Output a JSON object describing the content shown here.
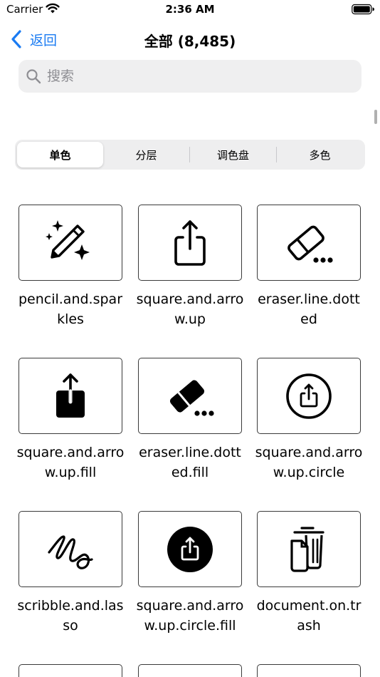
{
  "status": {
    "carrier": "Carrier",
    "time": "2:36 AM"
  },
  "nav": {
    "back_label": "返回",
    "title": "全部 (8,485)"
  },
  "search": {
    "placeholder": "搜索",
    "value": ""
  },
  "segments": [
    "单色",
    "分层",
    "调色盘",
    "多色"
  ],
  "selected_segment": "单色",
  "symbols": [
    {
      "name_line1": "pencil.and.spar",
      "name_line2": "kles",
      "icon": "pencil-sparkles-icon"
    },
    {
      "name_line1": "square.and.arro",
      "name_line2": "w.up",
      "icon": "share-icon"
    },
    {
      "name_line1": "eraser.line.dott",
      "name_line2": "ed",
      "icon": "eraser-dotted-icon"
    },
    {
      "name_line1": "square.and.arro",
      "name_line2": "w.up.fill",
      "icon": "share-fill-icon"
    },
    {
      "name_line1": "eraser.line.dott",
      "name_line2": "ed.fill",
      "icon": "eraser-dotted-fill-icon"
    },
    {
      "name_line1": "square.and.arro",
      "name_line2": "w.up.circle",
      "icon": "share-circle-icon"
    },
    {
      "name_line1": "scribble.and.las",
      "name_line2": "so",
      "icon": "scribble-lasso-icon"
    },
    {
      "name_line1": "square.and.arro",
      "name_line2": "w.up.circle.fill",
      "icon": "share-circle-fill-icon"
    },
    {
      "name_line1": "document.on.tr",
      "name_line2": "ash",
      "icon": "document-trash-icon"
    }
  ],
  "colors": {
    "accent": "#1a7bf2",
    "tile_border": "#3a3a3a",
    "segment_bg": "#eeeeef"
  }
}
